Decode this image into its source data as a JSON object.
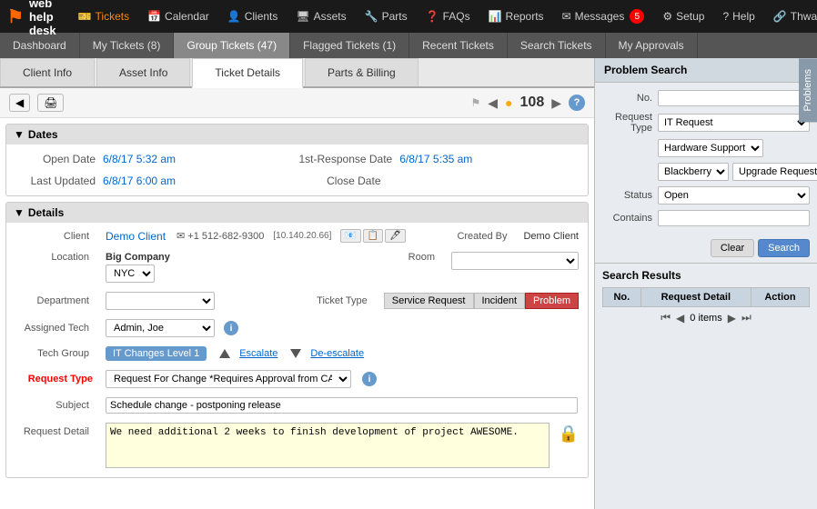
{
  "app": {
    "logo": "web help desk",
    "logo_symbol": "⚑"
  },
  "nav": {
    "items": [
      {
        "id": "tickets",
        "label": "Tickets",
        "icon": "🎫",
        "active": true,
        "badge": null
      },
      {
        "id": "calendar",
        "label": "Calendar",
        "icon": "📅",
        "active": false,
        "badge": null
      },
      {
        "id": "clients",
        "label": "Clients",
        "icon": "👤",
        "active": false,
        "badge": null
      },
      {
        "id": "assets",
        "label": "Assets",
        "icon": "🖥",
        "active": false,
        "badge": null
      },
      {
        "id": "parts",
        "label": "Parts",
        "icon": "🔧",
        "active": false,
        "badge": null
      },
      {
        "id": "faqs",
        "label": "FAQs",
        "icon": "❓",
        "active": false,
        "badge": null
      },
      {
        "id": "reports",
        "label": "Reports",
        "icon": "📊",
        "active": false,
        "badge": null
      },
      {
        "id": "messages",
        "label": "Messages",
        "icon": "✉",
        "active": false,
        "badge": "5"
      },
      {
        "id": "setup",
        "label": "Setup",
        "icon": "⚙",
        "active": false,
        "badge": null
      },
      {
        "id": "help",
        "label": "Help",
        "icon": "?",
        "active": false,
        "badge": null
      },
      {
        "id": "thwack",
        "label": "Thwack",
        "icon": "🔗",
        "active": false,
        "badge": null
      }
    ]
  },
  "tabs": [
    {
      "id": "dashboard",
      "label": "Dashboard",
      "active": false
    },
    {
      "id": "my-tickets",
      "label": "My Tickets (8)",
      "active": false
    },
    {
      "id": "group-tickets",
      "label": "Group Tickets (47)",
      "active": false
    },
    {
      "id": "flagged-tickets",
      "label": "Flagged Tickets (1)",
      "active": false
    },
    {
      "id": "recent-tickets",
      "label": "Recent Tickets",
      "active": false
    },
    {
      "id": "search-tickets",
      "label": "Search Tickets",
      "active": false
    },
    {
      "id": "my-approvals",
      "label": "My Approvals",
      "active": false
    }
  ],
  "content_tabs": [
    {
      "id": "client-info",
      "label": "Client Info",
      "active": false
    },
    {
      "id": "asset-info",
      "label": "Asset Info",
      "active": false
    },
    {
      "id": "ticket-details",
      "label": "Ticket Details",
      "active": true
    },
    {
      "id": "parts-billing",
      "label": "Parts & Billing",
      "active": false
    }
  ],
  "ticket": {
    "number": "108",
    "dates": {
      "open_label": "Open Date",
      "open_value": "6/8/17 5:32 am",
      "response_label": "1st-Response Date",
      "response_value": "6/8/17 5:35 am",
      "updated_label": "Last Updated",
      "updated_value": "6/8/17 6:00 am",
      "close_label": "Close Date",
      "close_value": ""
    },
    "client_label": "Client",
    "client_name": "Demo Client",
    "client_email": "✉ +1 512-682-9300",
    "client_ip": "[10.140.20.66]",
    "created_by_label": "Created By",
    "created_by": "Demo Client",
    "location_label": "Location",
    "location": "Big Company",
    "location_city": "NYC",
    "room_label": "Room",
    "department_label": "Department",
    "assigned_tech_label": "Assigned Tech",
    "assigned_tech": "Admin, Joe",
    "ticket_type_label": "Ticket Type",
    "ticket_types": [
      "Service Request",
      "Incident",
      "Problem"
    ],
    "ticket_type_active": "Problem",
    "tech_group_label": "Tech Group",
    "tech_group": "IT Changes Level 1",
    "escalate_label": "Escalate",
    "deescalate_label": "De-escalate",
    "request_type_label": "Request Type",
    "request_type": "Request For Change *Requires Approval from CAB",
    "subject_label": "Subject",
    "subject": "Schedule change - postponing release",
    "request_detail_label": "Request Detail",
    "request_detail": "We need additional 2 weeks to finish development of project AWESOME."
  },
  "problem_search": {
    "title": "Problem Search",
    "no_label": "No.",
    "request_type_label": "Request Type",
    "request_type_value": "IT Request",
    "hardware_support": "Hardware Support",
    "blackberry": "Blackberry",
    "upgrade_request": "Upgrade Request",
    "status_label": "Status",
    "status_value": "Open",
    "contains_label": "Contains",
    "clear_label": "Clear",
    "search_label": "Search",
    "results_title": "Search Results",
    "results_cols": [
      "No.",
      "Request Detail",
      "Action"
    ],
    "items_count": "0 items",
    "side_tab": "Problems"
  }
}
